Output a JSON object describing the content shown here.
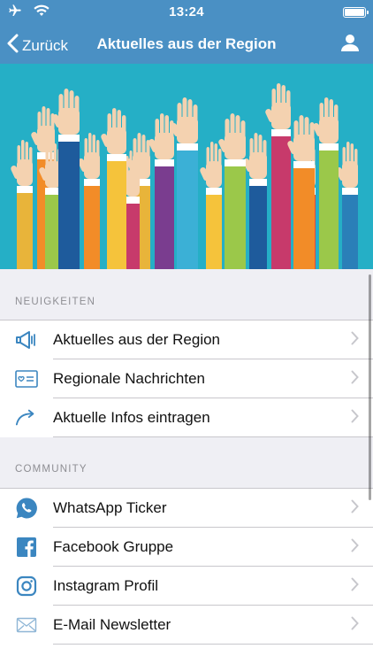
{
  "status_bar": {
    "time": "13:24",
    "icons": [
      "airplane-icon",
      "wifi-icon",
      "battery-icon"
    ]
  },
  "nav": {
    "back_label": "Zurück",
    "title": "Aktuelles aus der Region",
    "right_icon": "person-icon"
  },
  "colors": {
    "nav_bar": "#4a90c4",
    "icon_blue": "#3b86c0",
    "hero_bg": "#25afc6"
  },
  "sections": [
    {
      "header": "NEUIGKEITEN",
      "items": [
        {
          "label": "Aktuelles aus der Region",
          "icon": "megaphone-icon"
        },
        {
          "label": "Regionale Nachrichten",
          "icon": "news-card-icon"
        },
        {
          "label": "Aktuelle Infos eintragen",
          "icon": "share-arrow-icon"
        }
      ]
    },
    {
      "header": "COMMUNITY",
      "items": [
        {
          "label": "WhatsApp Ticker",
          "icon": "whatsapp-icon"
        },
        {
          "label": "Facebook Gruppe",
          "icon": "facebook-icon"
        },
        {
          "label": "Instagram Profil",
          "icon": "instagram-icon"
        },
        {
          "label": "E-Mail Newsletter",
          "icon": "mail-icon"
        }
      ]
    }
  ]
}
